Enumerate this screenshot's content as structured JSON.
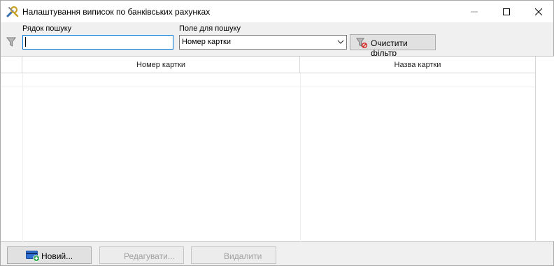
{
  "window": {
    "title": "Налаштування виписок по банківських рахунках"
  },
  "filter": {
    "search_label": "Рядок пошуку",
    "search_value": "",
    "field_label": "Поле для пошуку",
    "field_value": "Номер картки",
    "clear_button": "Очистити фільтр"
  },
  "grid": {
    "columns": [
      "Номер картки",
      "Назва картки"
    ],
    "rows": []
  },
  "actions": {
    "new": "Новий...",
    "edit": "Редагувати...",
    "delete": "Видалити"
  },
  "icons": {
    "title": "wrench-tools-icon",
    "filter": "funnel-icon",
    "clear": "clear-filter-icon",
    "new": "add-card-icon",
    "dropdown": "chevron-down-icon"
  },
  "colors": {
    "focus": "#0078d7",
    "window_bg": "#f0f0f0",
    "disabled_text": "#a0a0a0"
  }
}
